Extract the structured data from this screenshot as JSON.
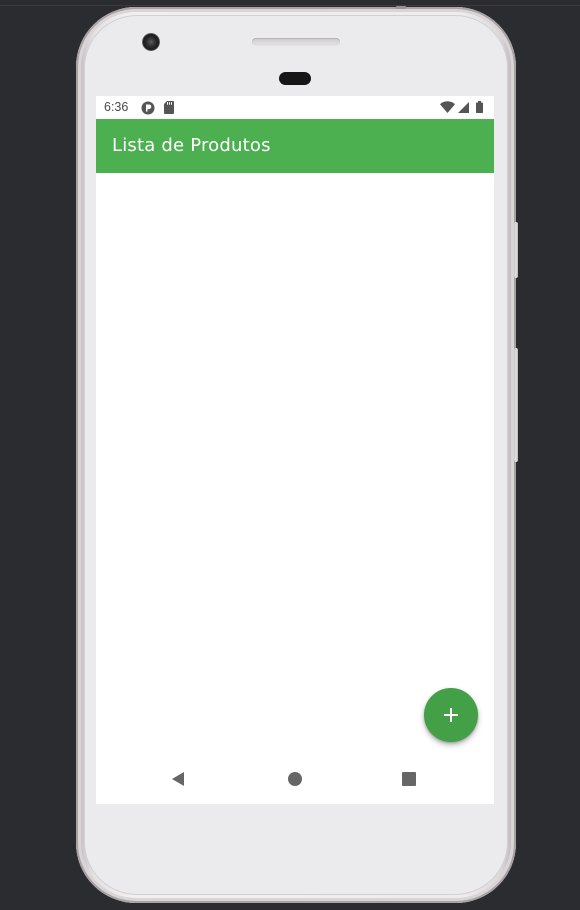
{
  "status_bar": {
    "time": "6:36",
    "left_icons": [
      "app-notification-icon",
      "sd-card-icon"
    ],
    "right_icons": [
      "wifi-icon",
      "cellular-signal-icon",
      "battery-icon"
    ]
  },
  "app_bar": {
    "title": "Lista de Produtos",
    "color": "#4caf50"
  },
  "product_list": {
    "items": []
  },
  "fab": {
    "icon": "plus-icon",
    "color": "#43a047"
  },
  "navigation_bar": {
    "buttons": [
      "back-icon",
      "home-icon",
      "recents-icon"
    ]
  }
}
